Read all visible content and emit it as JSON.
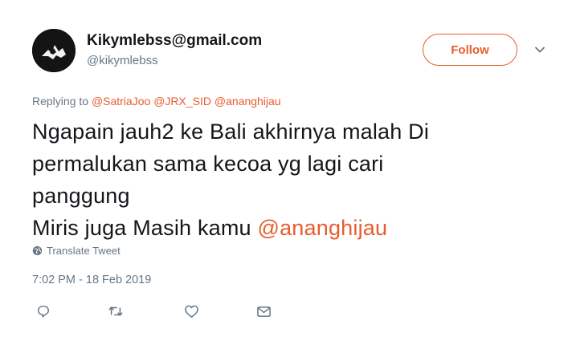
{
  "tweet": {
    "display_name": "Kikymlebss@gmail.com",
    "handle": "@kikymlebss",
    "follow_label": "Follow",
    "replying_prefix": "Replying to ",
    "replying_to": [
      "@SatriaJoo",
      "@JRX_SID",
      "@ananghijau"
    ],
    "text_lines": [
      "Ngapain jauh2 ke Bali akhirnya malah Di",
      "permalukan sama kecoa yg lagi cari",
      "panggung",
      "Miris juga Masih kamu "
    ],
    "text_mention": "@ananghijau",
    "translate_label": "Translate Tweet",
    "timestamp": "7:02 PM - 18 Feb 2019"
  },
  "icons": {
    "avatar": "avatar-image",
    "caret": "chevron-down-icon",
    "translate": "globe-icon",
    "reply": "reply-icon",
    "retweet": "retweet-icon",
    "like": "heart-icon",
    "dm": "envelope-icon"
  },
  "colors": {
    "accent": "#e95c2e",
    "text": "#14171a",
    "secondary": "#657786",
    "icon": "#657786"
  }
}
